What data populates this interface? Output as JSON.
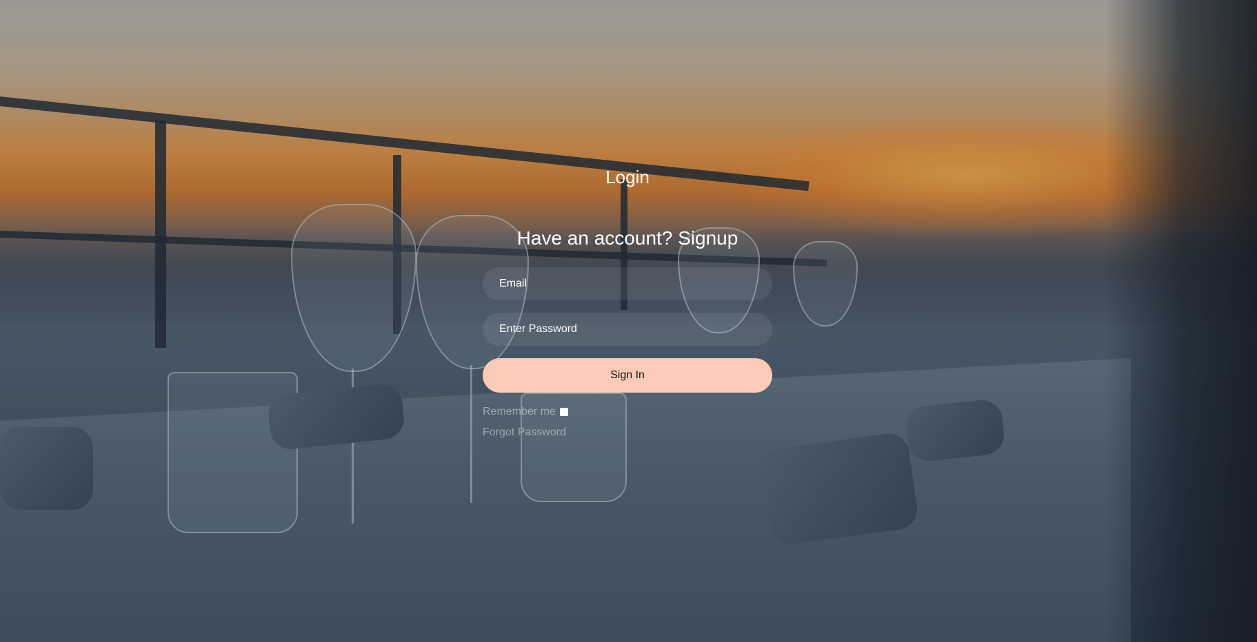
{
  "login": {
    "title": "Login",
    "signup_heading": "Have an account? Signup",
    "email_placeholder": "Email",
    "password_placeholder": "Enter Password",
    "signin_label": "Sign In",
    "remember_label": "Remember me",
    "forgot_label": "Forgot Password"
  },
  "colors": {
    "signin_button": "#fbcbb8",
    "text": "#ffffff",
    "muted_text": "rgba(255,255,255,0.45)"
  },
  "background": {
    "description_icon": "restaurant-table-sunset-image"
  }
}
